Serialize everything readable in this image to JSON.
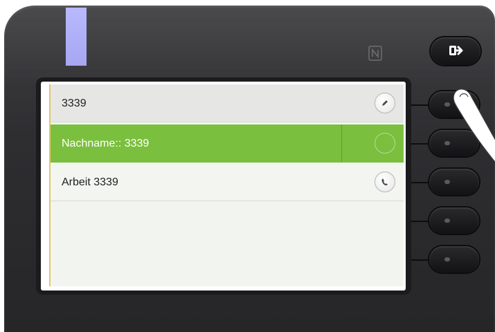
{
  "list": {
    "items": [
      {
        "label": "3339",
        "icon": "edit-icon"
      },
      {
        "label": "Nachname:: 3339",
        "icon": "empty-circle-icon",
        "selected": true
      },
      {
        "label": "Arbeit 3339",
        "icon": "phone-handset-icon"
      }
    ]
  },
  "icons": {
    "nfc": "nfc-icon",
    "exit": "exit-icon"
  },
  "colors": {
    "selected_row": "#7bbf3e",
    "header_row": "#e6e7e4",
    "led": "#b9b9ff",
    "bezel": "#2e2e31"
  }
}
